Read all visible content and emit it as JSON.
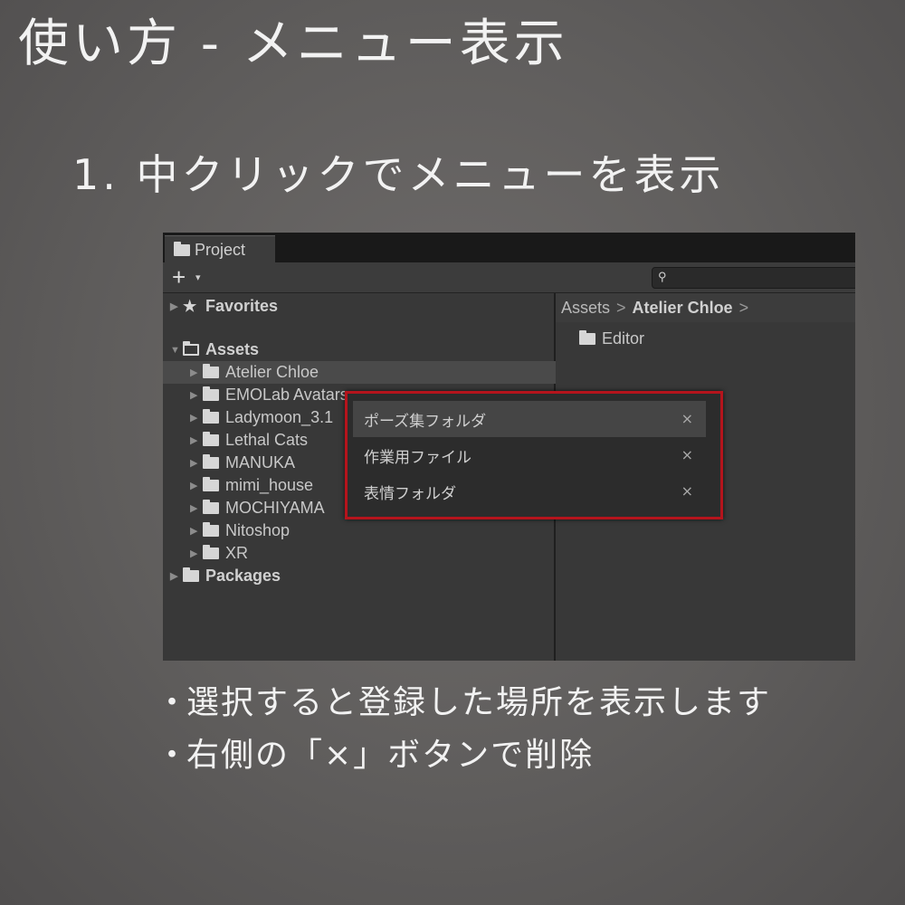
{
  "title": "使い方 - メニュー表示",
  "subtitle": "1. 中クリックでメニューを表示",
  "bullets": [
    "選択すると登録した場所を表示します",
    "右側の「×」ボタンで削除"
  ],
  "bullet_mark": "・",
  "window": {
    "tab_label": "Project",
    "toolbar": {
      "plus": "+",
      "dropdown": "▾",
      "search_icon": "magnifier-icon",
      "search_glyph": "⚲"
    },
    "tree": {
      "favorites": "Favorites",
      "assets": "Assets",
      "folders": [
        "Atelier Chloe",
        "EMOLab Avatars",
        "Ladymoon_3.1",
        "Lethal Cats",
        "MANUKA",
        "mimi_house",
        "MOCHIYAMA",
        "Nitoshop",
        "XR"
      ],
      "packages": "Packages",
      "arrow_collapsed": "▶",
      "arrow_expanded": "▼",
      "star_glyph": "★"
    },
    "breadcrumb": {
      "root": "Assets",
      "current": "Atelier Chloe",
      "separator": ">"
    },
    "content_items": [
      "Editor"
    ]
  },
  "popup_menu": {
    "items": [
      "ポーズ集フォルダ",
      "作業用ファイル",
      "表情フォルダ"
    ],
    "remove_glyph": "×",
    "highlight_color": "#b5141c"
  }
}
